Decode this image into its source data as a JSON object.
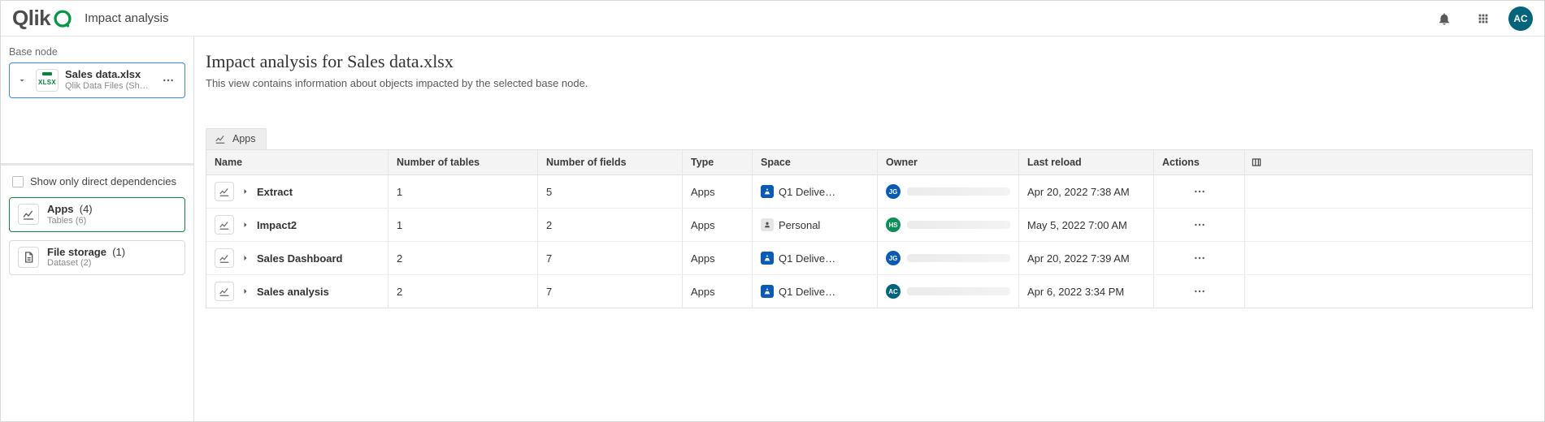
{
  "header": {
    "app_name": "Qlik",
    "page_title": "Impact analysis",
    "avatar_initials": "AC"
  },
  "sidebar": {
    "base_label": "Base node",
    "base_node": {
      "title": "Sales data.xlsx",
      "subtitle": "Qlik Data Files (Shared)"
    },
    "show_direct_label": "Show only direct dependencies",
    "cards": [
      {
        "title": "Apps",
        "count": "(4)",
        "subtitle": "Tables (6)"
      },
      {
        "title": "File storage",
        "count": "(1)",
        "subtitle": "Dataset (2)"
      }
    ]
  },
  "page": {
    "title": "Impact analysis for Sales data.xlsx",
    "subtitle": "This view contains information about objects impacted by the selected base node.",
    "tab_label": "Apps"
  },
  "table": {
    "headers": {
      "name": "Name",
      "tables": "Number of tables",
      "fields": "Number of fields",
      "type": "Type",
      "space": "Space",
      "owner": "Owner",
      "reload": "Last reload",
      "actions": "Actions"
    },
    "rows": [
      {
        "name": "Extract",
        "tables": "1",
        "fields": "5",
        "type": "Apps",
        "space": "Q1 Delive…",
        "space_kind": "shared",
        "owner_initials": "JG",
        "owner_color": "#0a5bb5",
        "reload": "Apr 20, 2022 7:38 AM"
      },
      {
        "name": "Impact2",
        "tables": "1",
        "fields": "2",
        "type": "Apps",
        "space": "Personal",
        "space_kind": "personal",
        "owner_initials": "HS",
        "owner_color": "#0b8f58",
        "reload": "May 5, 2022 7:00 AM"
      },
      {
        "name": "Sales Dashboard",
        "tables": "2",
        "fields": "7",
        "type": "Apps",
        "space": "Q1 Delive…",
        "space_kind": "shared",
        "owner_initials": "JG",
        "owner_color": "#0a5bb5",
        "reload": "Apr 20, 2022 7:39 AM"
      },
      {
        "name": "Sales analysis",
        "tables": "2",
        "fields": "7",
        "type": "Apps",
        "space": "Q1 Delive…",
        "space_kind": "shared",
        "owner_initials": "AC",
        "owner_color": "#00647a",
        "reload": "Apr 6, 2022 3:34 PM"
      }
    ]
  }
}
